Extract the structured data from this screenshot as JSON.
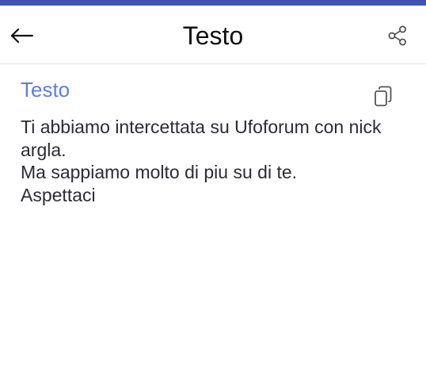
{
  "header": {
    "title": "Testo",
    "icons": {
      "back": "arrow-left-icon",
      "share": "share-icon"
    }
  },
  "content": {
    "section_title": "Testo",
    "copy_icon": "copy-icon",
    "text": "Ti abbiamo intercettata su Ufoforum con nick argla.\nMa sappiamo molto di piu su di te.\nAspettaci"
  },
  "colors": {
    "status_bar": "#3f51b5",
    "accent": "#5b7ee8",
    "text": "#2b2b33",
    "title": "#111111"
  }
}
